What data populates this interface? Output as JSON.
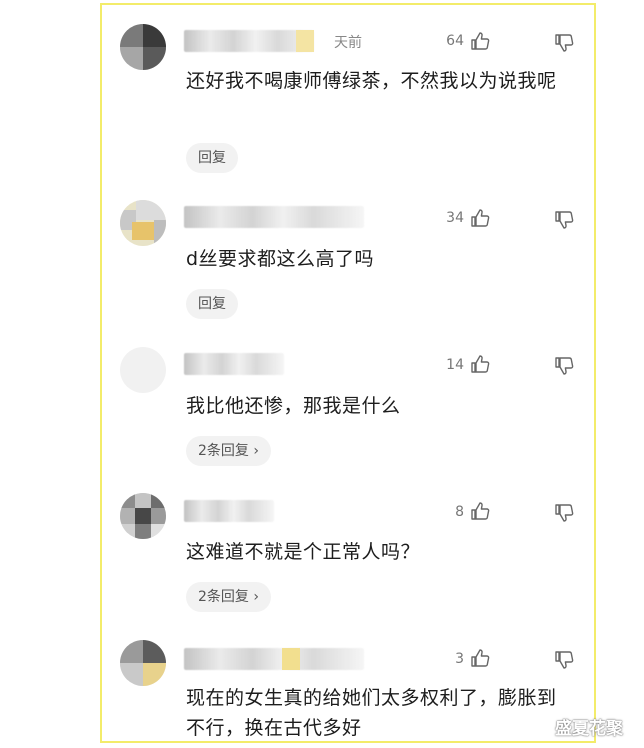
{
  "comments": [
    {
      "time": "天前",
      "likes": "64",
      "text": "还好我不喝康师傅绿茶，不然我以为说我呢",
      "reply_label": "回复"
    },
    {
      "time": "",
      "likes": "34",
      "text": "d丝要求都这么高了吗",
      "reply_label": "回复"
    },
    {
      "time": "",
      "likes": "14",
      "text": "我比他还惨，那我是什么",
      "reply_label": "2条回复 ›"
    },
    {
      "time": "",
      "likes": "8",
      "text": "这难道不就是个正常人吗？",
      "reply_label": "2条回复 ›"
    },
    {
      "time": "",
      "likes": "3",
      "text": "现在的女生真的给她们太多权利了，膨胀到不行，换在古代多好",
      "reply_label": ""
    }
  ],
  "icons": {
    "like": "thumbs-up-icon",
    "dislike": "thumbs-down-icon"
  },
  "watermark": "盛夏花聚"
}
